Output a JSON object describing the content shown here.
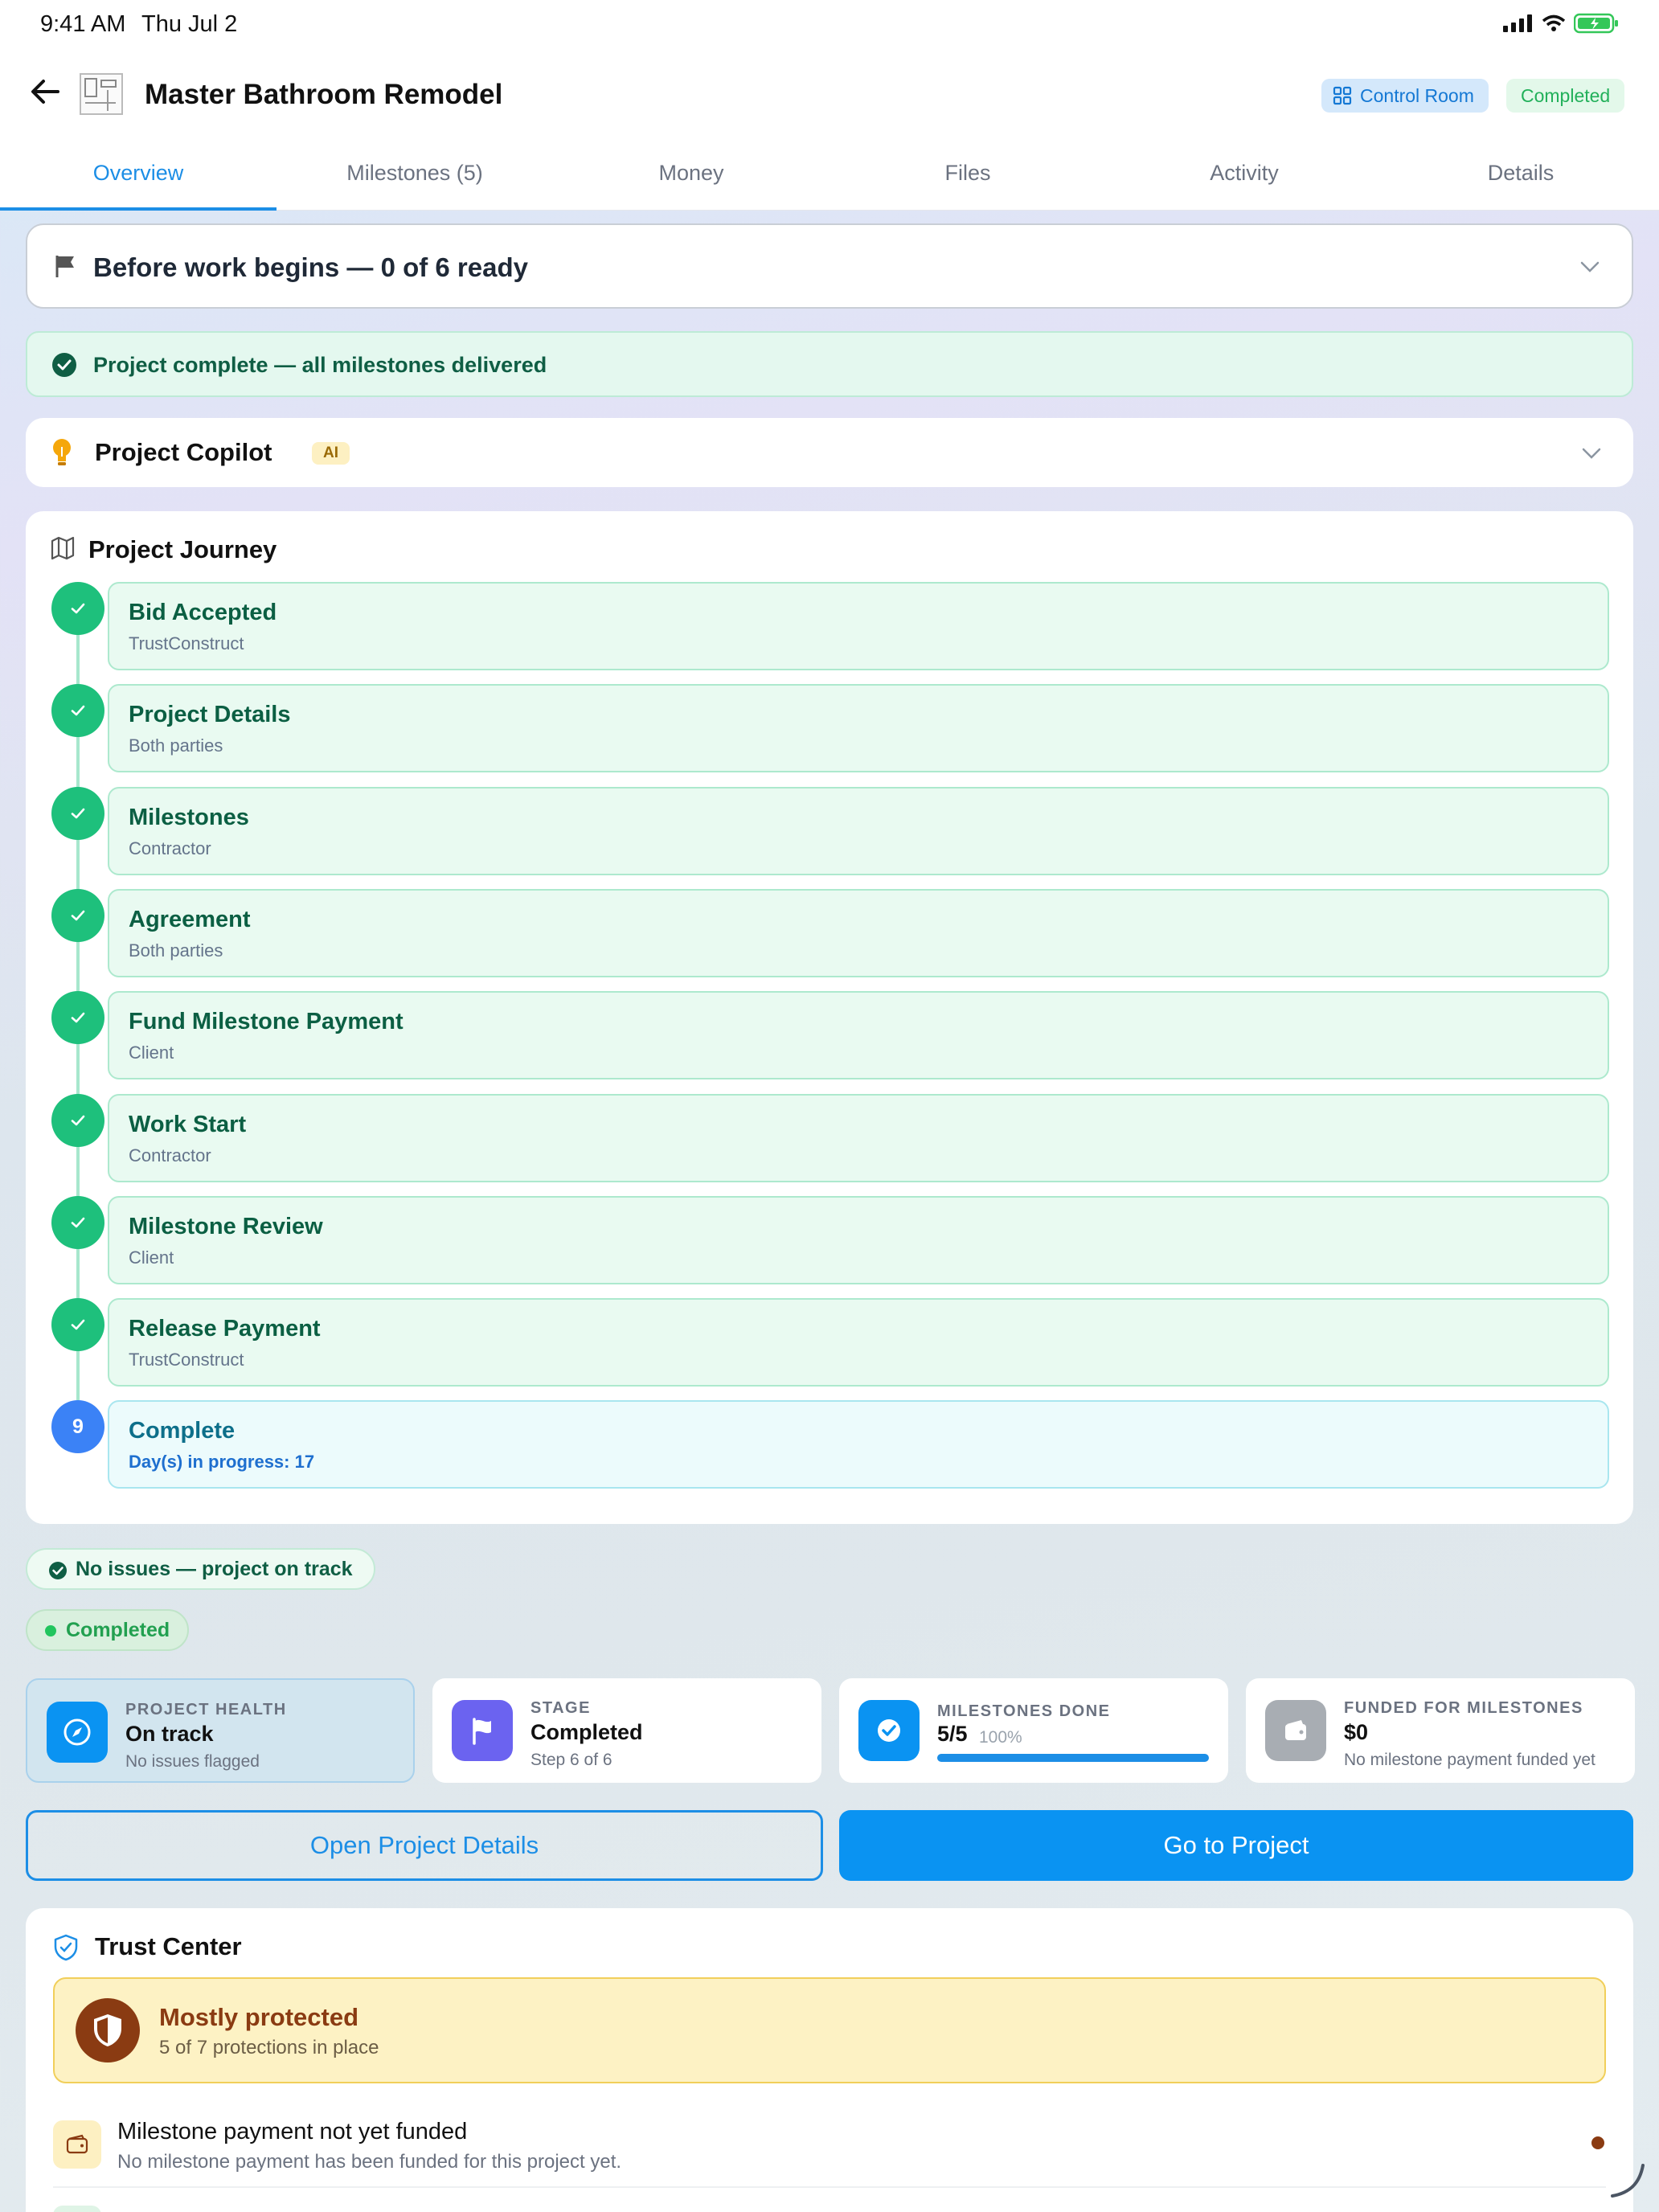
{
  "status": {
    "time": "9:41 AM",
    "date": "Thu Jul 2"
  },
  "header": {
    "title": "Master Bathroom Remodel",
    "control_room": "Control Room",
    "status_pill": "Completed"
  },
  "tabs": [
    {
      "label": "Overview",
      "active": true
    },
    {
      "label": "Milestones (5)"
    },
    {
      "label": "Money"
    },
    {
      "label": "Files"
    },
    {
      "label": "Activity"
    },
    {
      "label": "Details"
    }
  ],
  "before_work": {
    "label": "Before work begins — 0 of 6 ready"
  },
  "complete_banner": {
    "text": "Project complete — all milestones delivered"
  },
  "copilot": {
    "title": "Project Copilot",
    "badge": "AI"
  },
  "journey": {
    "title": "Project Journey",
    "steps": [
      {
        "name": "Bid Accepted",
        "sub": "TrustConstruct",
        "done": true
      },
      {
        "name": "Project Details",
        "sub": "Both parties",
        "done": true
      },
      {
        "name": "Milestones",
        "sub": "Contractor",
        "done": true
      },
      {
        "name": "Agreement",
        "sub": "Both parties",
        "done": true
      },
      {
        "name": "Fund Milestone Payment",
        "sub": "Client",
        "done": true
      },
      {
        "name": "Work Start",
        "sub": "Contractor",
        "done": true
      },
      {
        "name": "Milestone Review",
        "sub": "Client",
        "done": true
      },
      {
        "name": "Release Payment",
        "sub": "TrustConstruct",
        "done": true
      },
      {
        "name": "Complete",
        "sub": "Day(s) in progress: 17",
        "number": "9",
        "current": true
      }
    ]
  },
  "chips": {
    "no_issues": "No issues — project on track",
    "completed": "Completed"
  },
  "stats": {
    "health": {
      "label": "PROJECT HEALTH",
      "value": "On track",
      "sub": "No issues flagged"
    },
    "stage": {
      "label": "STAGE",
      "value": "Completed",
      "sub": "Step 6 of 6"
    },
    "milestones": {
      "label": "MILESTONES DONE",
      "value": "5/5",
      "percent": "100%",
      "progress": 1.0
    },
    "funded": {
      "label": "FUNDED FOR MILESTONES",
      "value": "$0",
      "sub": "No milestone payment funded yet"
    }
  },
  "buttons": {
    "open_details": "Open Project Details",
    "go_to_project": "Go to Project"
  },
  "trust": {
    "title": "Trust Center",
    "level": "Mostly protected",
    "level_sub": "5 of 7 protections in place",
    "items": [
      {
        "title": "Milestone payment not yet funded",
        "sub": "No milestone payment has been funded for this project yet."
      }
    ]
  },
  "colors": {
    "accent": "#1c8ee6",
    "success": "#1ec07c",
    "warning_bg": "#fdf2c4",
    "warning_text": "#8a3b12"
  }
}
